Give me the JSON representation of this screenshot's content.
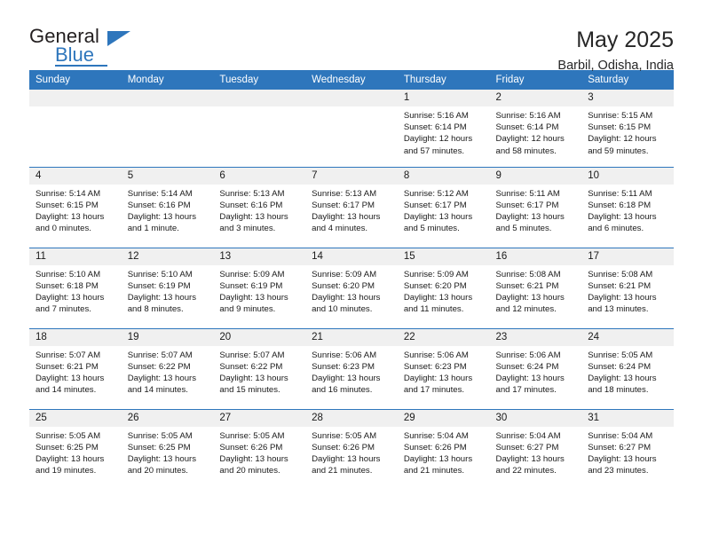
{
  "brand": {
    "name_top": "General",
    "name_bottom": "Blue",
    "accent_color": "#2e76bc",
    "triangle_icon": "brand-triangle-icon"
  },
  "header": {
    "title": "May 2025",
    "subtitle": "Barbil, Odisha, India"
  },
  "calendar": {
    "header_bg": "#2e76bc",
    "header_text_color": "#ffffff",
    "daynum_bg": "#f0f0f0",
    "weekday_headers": [
      "Sunday",
      "Monday",
      "Tuesday",
      "Wednesday",
      "Thursday",
      "Friday",
      "Saturday"
    ],
    "labels": {
      "sunrise": "Sunrise:",
      "sunset": "Sunset:",
      "daylight": "Daylight:"
    },
    "weeks": [
      [
        {
          "day": "",
          "blank": true
        },
        {
          "day": "",
          "blank": true
        },
        {
          "day": "",
          "blank": true
        },
        {
          "day": "",
          "blank": true
        },
        {
          "day": "1",
          "sunrise": "Sunrise: 5:16 AM",
          "sunset": "Sunset: 6:14 PM",
          "daylight_line1": "Daylight: 12 hours",
          "daylight_line2": "and 57 minutes."
        },
        {
          "day": "2",
          "sunrise": "Sunrise: 5:16 AM",
          "sunset": "Sunset: 6:14 PM",
          "daylight_line1": "Daylight: 12 hours",
          "daylight_line2": "and 58 minutes."
        },
        {
          "day": "3",
          "sunrise": "Sunrise: 5:15 AM",
          "sunset": "Sunset: 6:15 PM",
          "daylight_line1": "Daylight: 12 hours",
          "daylight_line2": "and 59 minutes."
        }
      ],
      [
        {
          "day": "4",
          "sunrise": "Sunrise: 5:14 AM",
          "sunset": "Sunset: 6:15 PM",
          "daylight_line1": "Daylight: 13 hours",
          "daylight_line2": "and 0 minutes."
        },
        {
          "day": "5",
          "sunrise": "Sunrise: 5:14 AM",
          "sunset": "Sunset: 6:16 PM",
          "daylight_line1": "Daylight: 13 hours",
          "daylight_line2": "and 1 minute."
        },
        {
          "day": "6",
          "sunrise": "Sunrise: 5:13 AM",
          "sunset": "Sunset: 6:16 PM",
          "daylight_line1": "Daylight: 13 hours",
          "daylight_line2": "and 3 minutes."
        },
        {
          "day": "7",
          "sunrise": "Sunrise: 5:13 AM",
          "sunset": "Sunset: 6:17 PM",
          "daylight_line1": "Daylight: 13 hours",
          "daylight_line2": "and 4 minutes."
        },
        {
          "day": "8",
          "sunrise": "Sunrise: 5:12 AM",
          "sunset": "Sunset: 6:17 PM",
          "daylight_line1": "Daylight: 13 hours",
          "daylight_line2": "and 5 minutes."
        },
        {
          "day": "9",
          "sunrise": "Sunrise: 5:11 AM",
          "sunset": "Sunset: 6:17 PM",
          "daylight_line1": "Daylight: 13 hours",
          "daylight_line2": "and 5 minutes."
        },
        {
          "day": "10",
          "sunrise": "Sunrise: 5:11 AM",
          "sunset": "Sunset: 6:18 PM",
          "daylight_line1": "Daylight: 13 hours",
          "daylight_line2": "and 6 minutes."
        }
      ],
      [
        {
          "day": "11",
          "sunrise": "Sunrise: 5:10 AM",
          "sunset": "Sunset: 6:18 PM",
          "daylight_line1": "Daylight: 13 hours",
          "daylight_line2": "and 7 minutes."
        },
        {
          "day": "12",
          "sunrise": "Sunrise: 5:10 AM",
          "sunset": "Sunset: 6:19 PM",
          "daylight_line1": "Daylight: 13 hours",
          "daylight_line2": "and 8 minutes."
        },
        {
          "day": "13",
          "sunrise": "Sunrise: 5:09 AM",
          "sunset": "Sunset: 6:19 PM",
          "daylight_line1": "Daylight: 13 hours",
          "daylight_line2": "and 9 minutes."
        },
        {
          "day": "14",
          "sunrise": "Sunrise: 5:09 AM",
          "sunset": "Sunset: 6:20 PM",
          "daylight_line1": "Daylight: 13 hours",
          "daylight_line2": "and 10 minutes."
        },
        {
          "day": "15",
          "sunrise": "Sunrise: 5:09 AM",
          "sunset": "Sunset: 6:20 PM",
          "daylight_line1": "Daylight: 13 hours",
          "daylight_line2": "and 11 minutes."
        },
        {
          "day": "16",
          "sunrise": "Sunrise: 5:08 AM",
          "sunset": "Sunset: 6:21 PM",
          "daylight_line1": "Daylight: 13 hours",
          "daylight_line2": "and 12 minutes."
        },
        {
          "day": "17",
          "sunrise": "Sunrise: 5:08 AM",
          "sunset": "Sunset: 6:21 PM",
          "daylight_line1": "Daylight: 13 hours",
          "daylight_line2": "and 13 minutes."
        }
      ],
      [
        {
          "day": "18",
          "sunrise": "Sunrise: 5:07 AM",
          "sunset": "Sunset: 6:21 PM",
          "daylight_line1": "Daylight: 13 hours",
          "daylight_line2": "and 14 minutes."
        },
        {
          "day": "19",
          "sunrise": "Sunrise: 5:07 AM",
          "sunset": "Sunset: 6:22 PM",
          "daylight_line1": "Daylight: 13 hours",
          "daylight_line2": "and 14 minutes."
        },
        {
          "day": "20",
          "sunrise": "Sunrise: 5:07 AM",
          "sunset": "Sunset: 6:22 PM",
          "daylight_line1": "Daylight: 13 hours",
          "daylight_line2": "and 15 minutes."
        },
        {
          "day": "21",
          "sunrise": "Sunrise: 5:06 AM",
          "sunset": "Sunset: 6:23 PM",
          "daylight_line1": "Daylight: 13 hours",
          "daylight_line2": "and 16 minutes."
        },
        {
          "day": "22",
          "sunrise": "Sunrise: 5:06 AM",
          "sunset": "Sunset: 6:23 PM",
          "daylight_line1": "Daylight: 13 hours",
          "daylight_line2": "and 17 minutes."
        },
        {
          "day": "23",
          "sunrise": "Sunrise: 5:06 AM",
          "sunset": "Sunset: 6:24 PM",
          "daylight_line1": "Daylight: 13 hours",
          "daylight_line2": "and 17 minutes."
        },
        {
          "day": "24",
          "sunrise": "Sunrise: 5:05 AM",
          "sunset": "Sunset: 6:24 PM",
          "daylight_line1": "Daylight: 13 hours",
          "daylight_line2": "and 18 minutes."
        }
      ],
      [
        {
          "day": "25",
          "sunrise": "Sunrise: 5:05 AM",
          "sunset": "Sunset: 6:25 PM",
          "daylight_line1": "Daylight: 13 hours",
          "daylight_line2": "and 19 minutes."
        },
        {
          "day": "26",
          "sunrise": "Sunrise: 5:05 AM",
          "sunset": "Sunset: 6:25 PM",
          "daylight_line1": "Daylight: 13 hours",
          "daylight_line2": "and 20 minutes."
        },
        {
          "day": "27",
          "sunrise": "Sunrise: 5:05 AM",
          "sunset": "Sunset: 6:26 PM",
          "daylight_line1": "Daylight: 13 hours",
          "daylight_line2": "and 20 minutes."
        },
        {
          "day": "28",
          "sunrise": "Sunrise: 5:05 AM",
          "sunset": "Sunset: 6:26 PM",
          "daylight_line1": "Daylight: 13 hours",
          "daylight_line2": "and 21 minutes."
        },
        {
          "day": "29",
          "sunrise": "Sunrise: 5:04 AM",
          "sunset": "Sunset: 6:26 PM",
          "daylight_line1": "Daylight: 13 hours",
          "daylight_line2": "and 21 minutes."
        },
        {
          "day": "30",
          "sunrise": "Sunrise: 5:04 AM",
          "sunset": "Sunset: 6:27 PM",
          "daylight_line1": "Daylight: 13 hours",
          "daylight_line2": "and 22 minutes."
        },
        {
          "day": "31",
          "sunrise": "Sunrise: 5:04 AM",
          "sunset": "Sunset: 6:27 PM",
          "daylight_line1": "Daylight: 13 hours",
          "daylight_line2": "and 23 minutes."
        }
      ]
    ]
  }
}
